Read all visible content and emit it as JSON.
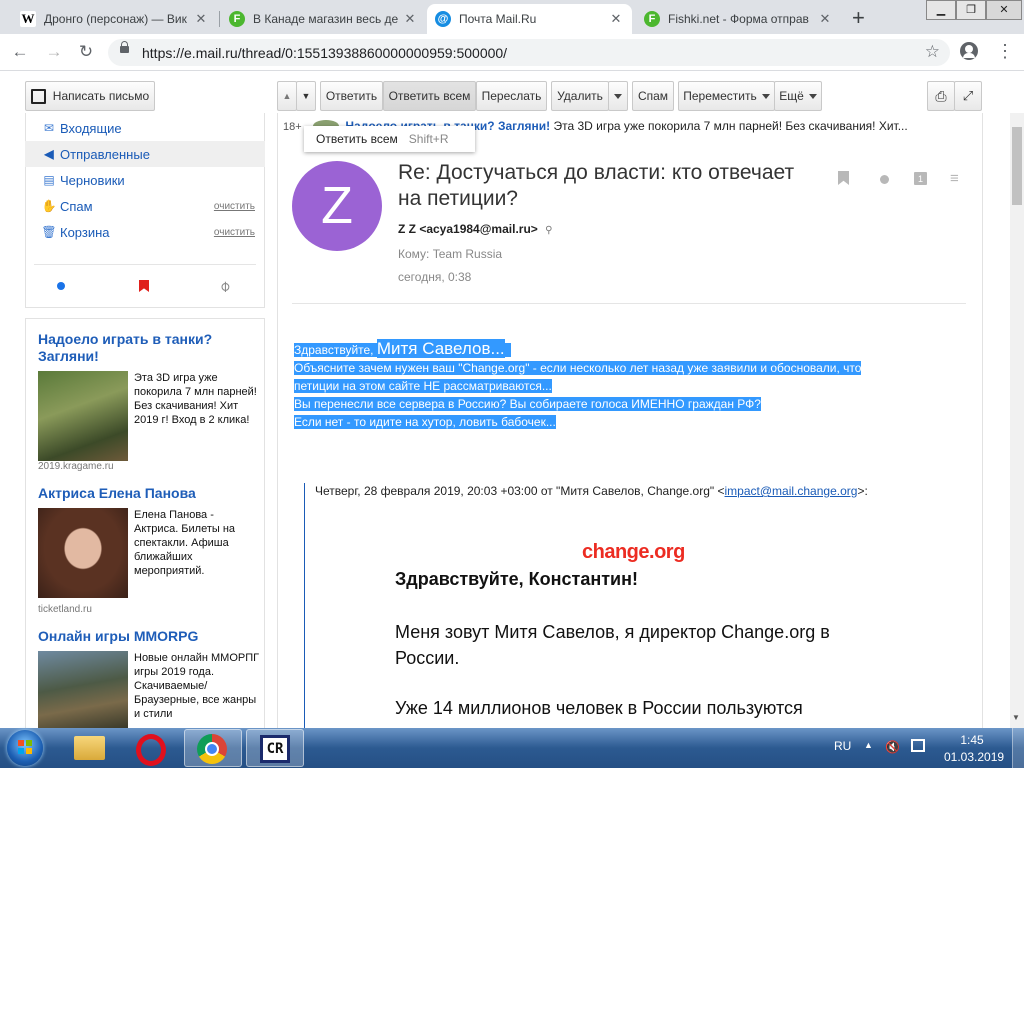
{
  "browser": {
    "tabs": [
      {
        "title": "Дронго (персонаж) — Вик",
        "favicon": "W",
        "favicon_color": "#000000",
        "favicon_bg": "#ffffff"
      },
      {
        "title": "В Канаде магазин весь де",
        "favicon": "F",
        "favicon_color": "#ffffff",
        "favicon_bg": "#4cb72f"
      },
      {
        "title": "Почта Mail.Ru",
        "favicon": "@",
        "favicon_color": "#ffffff",
        "favicon_bg": "#168de2"
      },
      {
        "title": "Fishki.net - Форма отправ",
        "favicon": "F",
        "favicon_color": "#ffffff",
        "favicon_bg": "#4cb72f"
      }
    ],
    "new_tab_label": "+",
    "url": "https://e.mail.ru/thread/0:15513938860000000959:500000/"
  },
  "toolbar": {
    "compose_label": "Написать письмо",
    "reply_label": "Ответить",
    "reply_all_label": "Ответить всем",
    "forward_label": "Переслать",
    "delete_label": "Удалить",
    "spam_label": "Спам",
    "move_label": "Переместить",
    "more_label": "Ещё"
  },
  "tooltip": {
    "label": "Ответить всем",
    "shortcut": "Shift+R"
  },
  "sidebar": {
    "folders": [
      {
        "label": "Входящие",
        "icon": "envelope-icon",
        "clear": ""
      },
      {
        "label": "Отправленные",
        "icon": "reply-arrow-icon",
        "clear": ""
      },
      {
        "label": "Черновики",
        "icon": "draft-icon",
        "clear": ""
      },
      {
        "label": "Спам",
        "icon": "thumbs-down-icon",
        "clear": "очистить"
      },
      {
        "label": "Корзина",
        "icon": "trash-icon",
        "clear": "очистить"
      }
    ],
    "active_folder": "Отправленные",
    "filter_colors": {
      "unread": "#1a73e8",
      "flag": "#e0201b",
      "attach": "#888888"
    }
  },
  "ads": [
    {
      "title": "Надоело играть в танки? Загляни!",
      "text": "Эта 3D игра уже покорила 7 млн парней! Без скачивания! Хит 2019 г! Вход в 2 клика!",
      "source": "2019.kragame.ru"
    },
    {
      "title": "Актриса Елена Панова",
      "text": "Елена Панова - Актриса. Билеты на спектакли. Афиша ближайших мероприятий.",
      "source": "ticketland.ru"
    },
    {
      "title": "Онлайн игры MMORPG",
      "text": "Новые онлайн ММОРПГ игры 2019 года. Скачиваемые/ Браузерные, все жанры и стили",
      "source": ""
    }
  ],
  "top_ad": {
    "age": "18+",
    "title": "Надоело играть в танки? Загляни!",
    "text": "Эта 3D игра уже покорила 7 млн парней! Без скачивания! Хит..."
  },
  "message": {
    "avatar_letter": "Z",
    "avatar_color": "#9b63d4",
    "subject": "Re: Достучаться до власти: кто отвечает на петиции?",
    "from": "Z Z <acya1984@mail.ru>",
    "to": "Кому: Team Russia",
    "date": "сегодня, 0:38",
    "body": {
      "greeting": "Здравствуйте, ",
      "greeting_name": "Митя Савелов...",
      "lines": [
        "Объясните зачем нужен ваш  \"Change.org\" - если несколько лет назад уже заявили и обосновали, что",
        "петиции на этом сайте НЕ рассматриваются...",
        "Вы перенесли все сервера в Россию? Вы собираете голоса ИМЕННО  граждан РФ?",
        "Если нет - то идите на хутор, ловить бабочек..."
      ]
    },
    "quote": {
      "header_prefix": "Четверг, 28 февраля 2019, 20:03 +03:00 от \"Митя Савелов, Change.org\" <",
      "header_email": "impact@mail.change.org",
      "header_suffix": ">:",
      "logo": "change.org",
      "greeting": "Здравствуйте, Константин!",
      "para1": "Меня зовут Митя Савелов, я директор Change.org в России.",
      "para2": "Уже 14 миллионов человек в России пользуются"
    }
  },
  "taskbar": {
    "lang": "RU",
    "time": "1:45",
    "date": "01.03.2019",
    "apps": [
      "windows-explorer",
      "opera",
      "chrome",
      "cr-app"
    ]
  }
}
